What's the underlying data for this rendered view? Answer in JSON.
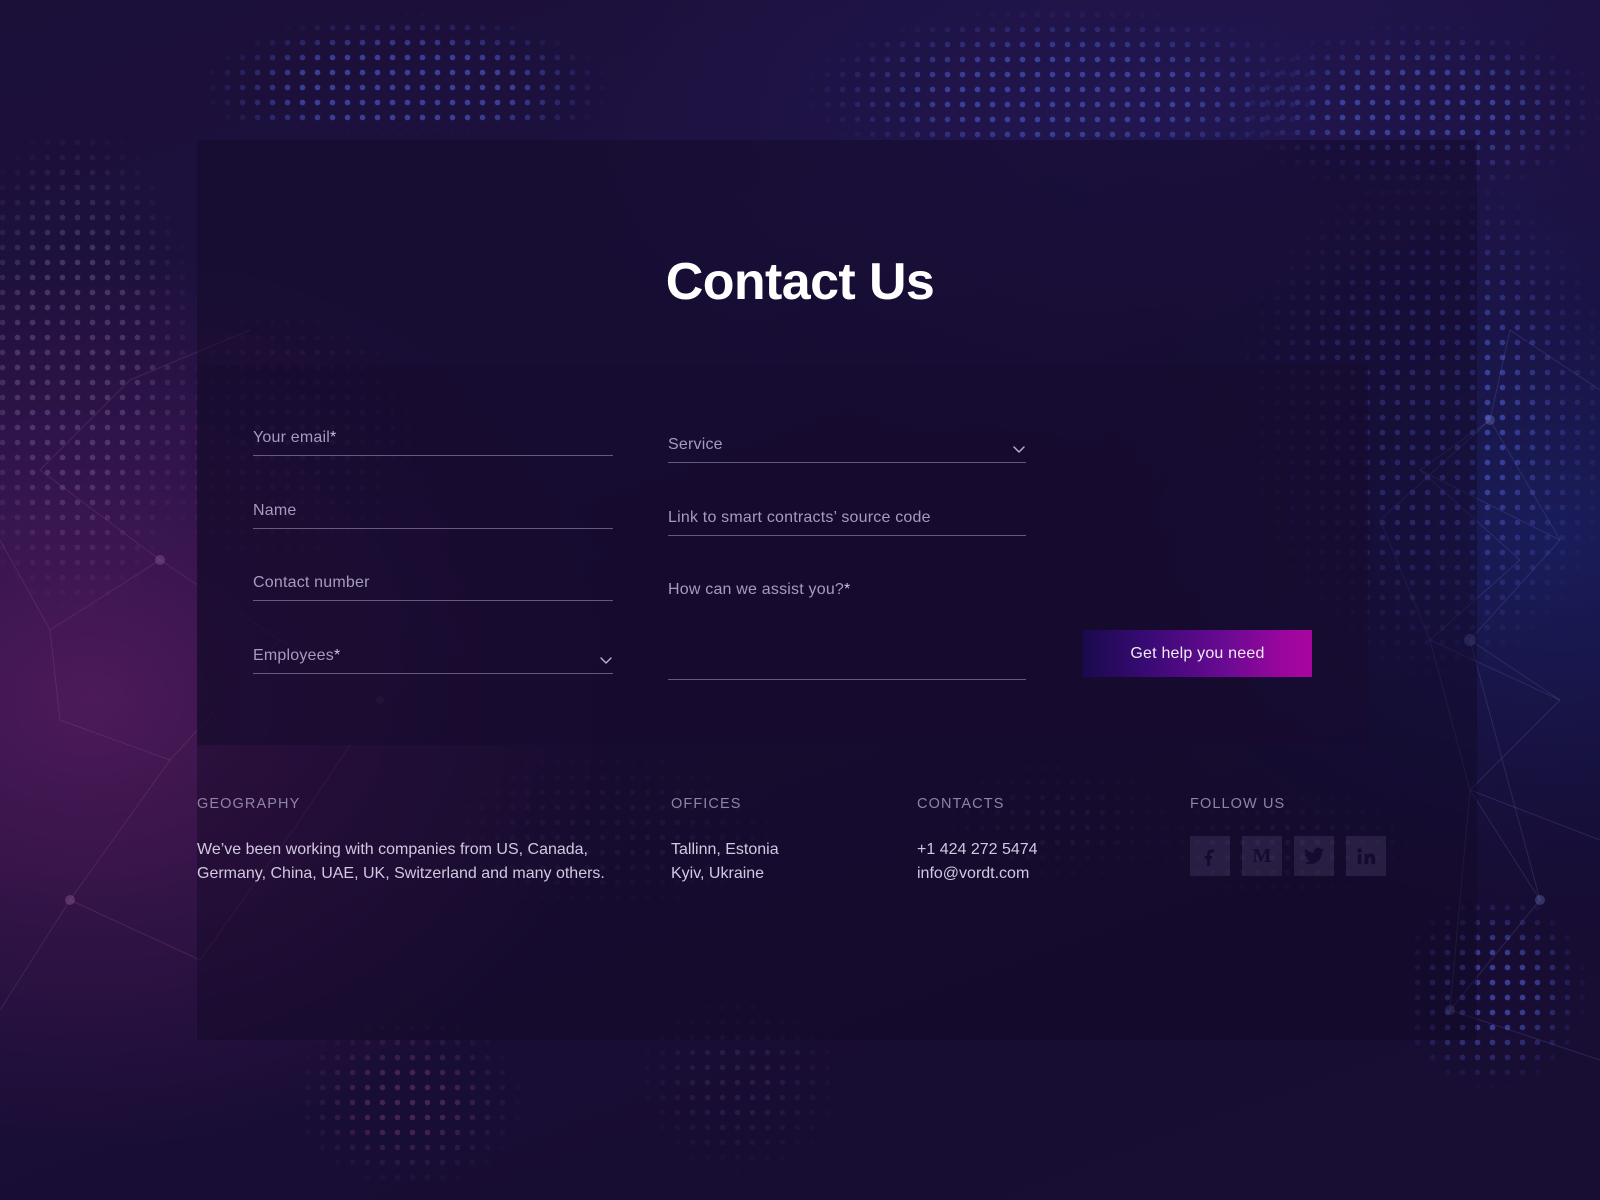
{
  "page": {
    "title": "Contact Us"
  },
  "form": {
    "fields": [
      {
        "id": "email",
        "label": "Your email",
        "required": "*",
        "type": "text",
        "value": ""
      },
      {
        "id": "name",
        "label": "Name",
        "required": "",
        "type": "text",
        "value": ""
      },
      {
        "id": "phone",
        "label": "Contact number",
        "required": "",
        "type": "text",
        "value": ""
      },
      {
        "id": "employees",
        "label": "Employees",
        "required": "*",
        "type": "select",
        "value": ""
      },
      {
        "id": "service",
        "label": "Service",
        "required": "",
        "type": "select",
        "value": ""
      },
      {
        "id": "link",
        "label": "Link to smart contracts’ source code",
        "required": "",
        "type": "text",
        "value": ""
      },
      {
        "id": "assist",
        "label": "How can we assist you?",
        "required": "*",
        "type": "textarea",
        "value": ""
      }
    ],
    "labels": {
      "email": "Your email",
      "email_req": "*",
      "name": "Name",
      "phone": "Contact number",
      "employees": "Employees",
      "employees_req": "*",
      "service": "Service",
      "link": "Link to smart contracts’ source code",
      "assist": "How can we assist you?",
      "assist_req": "*"
    },
    "submit_label": "Get help you need",
    "chevron_icon": "chevron-down-icon"
  },
  "footer": {
    "geography": {
      "heading": "GEOGRAPHY",
      "text": "We’ve been working with companies from US, Canada, Germany, China, UAE, UK, Switzerland and many others."
    },
    "offices": {
      "heading": "OFFICES",
      "items": [
        "Tallinn, Estonia",
        "Kyiv, Ukraine"
      ],
      "line1": "Tallinn, Estonia",
      "line2": "Kyiv, Ukraine"
    },
    "contacts": {
      "heading": "CONTACTS",
      "phone": "+1 424 272 5474",
      "email": "info@vordt.com"
    },
    "follow": {
      "heading": "FOLLOW US",
      "socials": [
        {
          "name": "facebook-icon",
          "glyph": "f"
        },
        {
          "name": "medium-icon",
          "glyph": "M"
        },
        {
          "name": "twitter-icon",
          "glyph": "bird"
        },
        {
          "name": "linkedin-icon",
          "glyph": "in"
        }
      ]
    }
  },
  "theme": {
    "background_dark": "#170c32",
    "background_panel": "#160b2e",
    "accent_gradient_start": "#190a4d",
    "accent_gradient_end": "#a8059f",
    "text_primary": "#ffffff",
    "text_secondary": "#d2c8e0",
    "text_muted": "#8f84a5",
    "field_underline": "#c6bada"
  }
}
